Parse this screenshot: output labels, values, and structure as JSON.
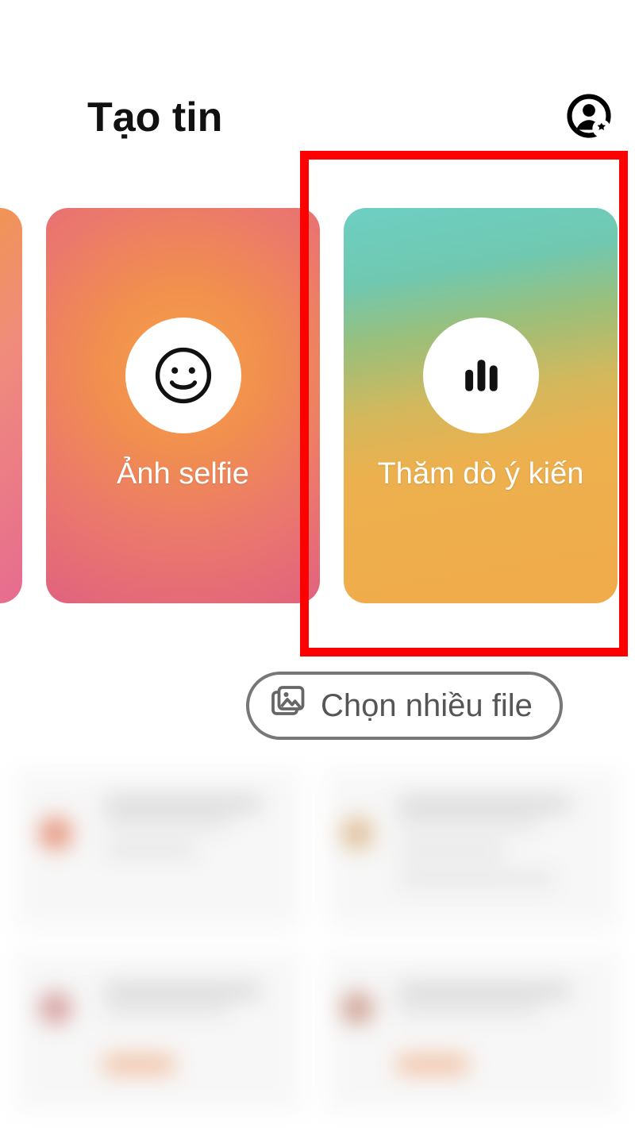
{
  "header": {
    "title": "Tạo tin",
    "settings_icon": "user-settings"
  },
  "cards": {
    "selfie": {
      "label": "Ảnh selfie",
      "icon": "smile"
    },
    "poll": {
      "label": "Thăm dò ý kiến",
      "icon": "poll-bars"
    }
  },
  "controls": {
    "multi_select_label": "Chọn nhiều file",
    "multi_select_icon": "gallery"
  },
  "highlight": {
    "target": "poll-card",
    "color": "#ff0000"
  }
}
